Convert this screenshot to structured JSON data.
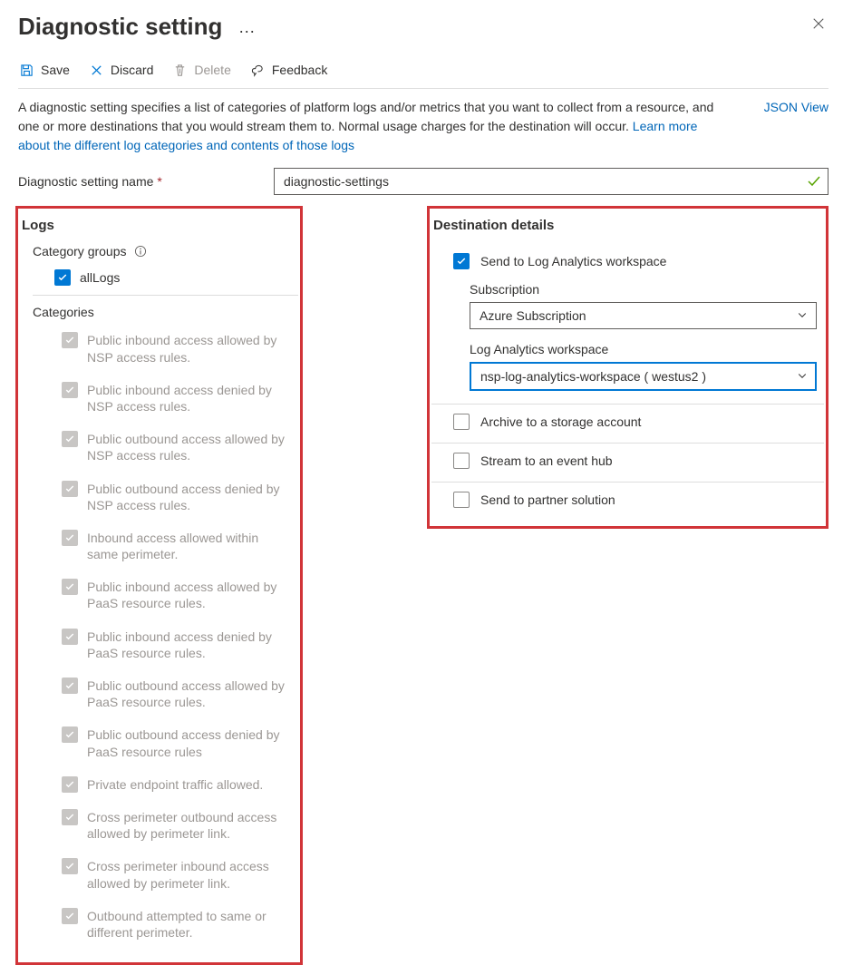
{
  "header": {
    "title": "Diagnostic setting"
  },
  "toolbar": {
    "save": "Save",
    "discard": "Discard",
    "delete": "Delete",
    "feedback": "Feedback"
  },
  "description": {
    "text": "A diagnostic setting specifies a list of categories of platform logs and/or metrics that you want to collect from a resource, and one or more destinations that you would stream them to. Normal usage charges for the destination will occur. ",
    "link": "Learn more about the different log categories and contents of those logs",
    "json_view": "JSON View"
  },
  "name_field": {
    "label": "Diagnostic setting name",
    "value": "diagnostic-settings"
  },
  "logs": {
    "title": "Logs",
    "category_groups_label": "Category groups",
    "allLogs": "allLogs",
    "categories_label": "Categories",
    "categories": [
      "Public inbound access allowed by NSP access rules.",
      "Public inbound access denied by NSP access rules.",
      "Public outbound access allowed by NSP access rules.",
      "Public outbound access denied by NSP access rules.",
      "Inbound access allowed within same perimeter.",
      "Public inbound access allowed by PaaS resource rules.",
      "Public inbound access denied by PaaS resource rules.",
      "Public outbound access allowed by PaaS resource rules.",
      "Public outbound access denied by PaaS resource rules",
      "Private endpoint traffic allowed.",
      "Cross perimeter outbound access allowed by perimeter link.",
      "Cross perimeter inbound access allowed by perimeter link.",
      "Outbound attempted to same or different perimeter."
    ]
  },
  "destination": {
    "title": "Destination details",
    "log_analytics_label": "Send to Log Analytics workspace",
    "subscription_label": "Subscription",
    "subscription_value": "Azure Subscription",
    "workspace_label": "Log Analytics workspace",
    "workspace_value": "nsp-log-analytics-workspace ( westus2 )",
    "storage_label": "Archive to a storage account",
    "eventhub_label": "Stream to an event hub",
    "partner_label": "Send to partner solution"
  }
}
